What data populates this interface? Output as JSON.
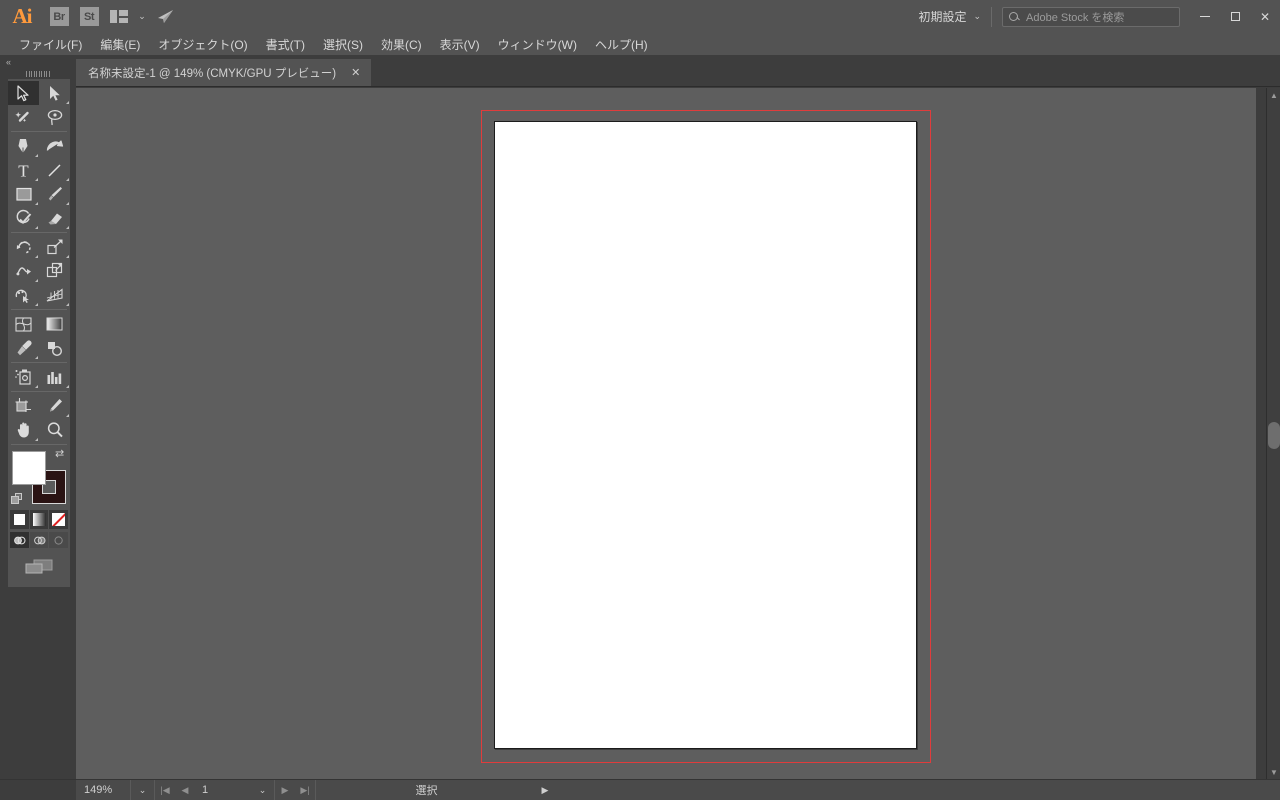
{
  "app": {
    "name": "Ai",
    "logo_color": "#ff9a3c"
  },
  "appbar": {
    "bridge_label": "Br",
    "stock_label": "St",
    "arrange_label": "arrange-documents",
    "chevron": "⌄",
    "rocket": "➤"
  },
  "workspace": {
    "label": "初期設定",
    "chevron": "⌄"
  },
  "search": {
    "placeholder": "Adobe Stock を検索",
    "value": ""
  },
  "window_controls": {
    "minimize": "—",
    "maximize": "□",
    "close": "✕"
  },
  "menu": {
    "items": [
      {
        "label": "ファイル(F)"
      },
      {
        "label": "編集(E)"
      },
      {
        "label": "オブジェクト(O)"
      },
      {
        "label": "書式(T)"
      },
      {
        "label": "選択(S)"
      },
      {
        "label": "効果(C)"
      },
      {
        "label": "表示(V)"
      },
      {
        "label": "ウィンドウ(W)"
      },
      {
        "label": "ヘルプ(H)"
      }
    ]
  },
  "tabs": [
    {
      "title": "名称未設定-1 @ 149% (CMYK/GPU プレビュー)",
      "close": "✕",
      "active": true
    }
  ],
  "toolpanel": {
    "collapse_label": "«",
    "rows": [
      [
        {
          "name": "selection-tool",
          "selected": true,
          "flyout": false
        },
        {
          "name": "direct-selection-tool",
          "selected": false,
          "flyout": true
        }
      ],
      [
        {
          "name": "magic-wand-tool",
          "selected": false,
          "flyout": false
        },
        {
          "name": "lasso-tool",
          "selected": false,
          "flyout": false
        }
      ],
      [
        {
          "name": "pen-tool",
          "selected": false,
          "flyout": true
        },
        {
          "name": "curvature-tool",
          "selected": false,
          "flyout": false
        }
      ],
      [
        {
          "name": "type-tool",
          "selected": false,
          "flyout": true
        },
        {
          "name": "line-segment-tool",
          "selected": false,
          "flyout": true
        }
      ],
      [
        {
          "name": "rectangle-tool",
          "selected": false,
          "flyout": true
        },
        {
          "name": "paintbrush-tool",
          "selected": false,
          "flyout": true
        }
      ],
      [
        {
          "name": "shaper-tool",
          "selected": false,
          "flyout": true
        },
        {
          "name": "eraser-tool",
          "selected": false,
          "flyout": true
        }
      ],
      [
        {
          "name": "rotate-tool",
          "selected": false,
          "flyout": true
        },
        {
          "name": "scale-tool",
          "selected": false,
          "flyout": true
        }
      ],
      [
        {
          "name": "width-tool",
          "selected": false,
          "flyout": true
        },
        {
          "name": "free-transform-tool",
          "selected": false,
          "flyout": false
        }
      ],
      [
        {
          "name": "shape-builder-tool",
          "selected": false,
          "flyout": true
        },
        {
          "name": "perspective-grid-tool",
          "selected": false,
          "flyout": true
        }
      ],
      [
        {
          "name": "mesh-tool",
          "selected": false,
          "flyout": false
        },
        {
          "name": "gradient-tool",
          "selected": false,
          "flyout": false
        }
      ],
      [
        {
          "name": "eyedropper-tool",
          "selected": false,
          "flyout": true
        },
        {
          "name": "blend-tool",
          "selected": false,
          "flyout": false
        }
      ],
      [
        {
          "name": "symbol-sprayer-tool",
          "selected": false,
          "flyout": true
        },
        {
          "name": "column-graph-tool",
          "selected": false,
          "flyout": true
        }
      ],
      [
        {
          "name": "artboard-tool",
          "selected": false,
          "flyout": false
        },
        {
          "name": "slice-tool",
          "selected": false,
          "flyout": true
        }
      ],
      [
        {
          "name": "hand-tool",
          "selected": false,
          "flyout": true
        },
        {
          "name": "zoom-tool",
          "selected": false,
          "flyout": false
        }
      ]
    ],
    "colors": {
      "fill": "#ffffff",
      "stroke": "#2a1313",
      "swap_icon": "⇄"
    },
    "paint_modes": [
      {
        "name": "color-mode",
        "active": true
      },
      {
        "name": "gradient-mode",
        "active": false
      },
      {
        "name": "none-mode",
        "active": false
      }
    ],
    "draw_modes": [
      {
        "name": "draw-normal",
        "active": true
      },
      {
        "name": "draw-behind",
        "active": false
      },
      {
        "name": "draw-inside",
        "active": false
      }
    ],
    "screen_mode": "change-screen-mode"
  },
  "canvas": {
    "bleed_color": "#e03c3c",
    "artboard_color": "#ffffff",
    "background_color": "#5e5e5e"
  },
  "statusbar": {
    "zoom": "149%",
    "zoom_chevron": "⌄",
    "first_page": "|◀",
    "prev_page": "◀",
    "page": "1",
    "page_chevron": "⌄",
    "next_page": "▶",
    "last_page": "▶|",
    "status_text": "選択",
    "play": "▶",
    "collapse": "‹",
    "expand": "›"
  }
}
